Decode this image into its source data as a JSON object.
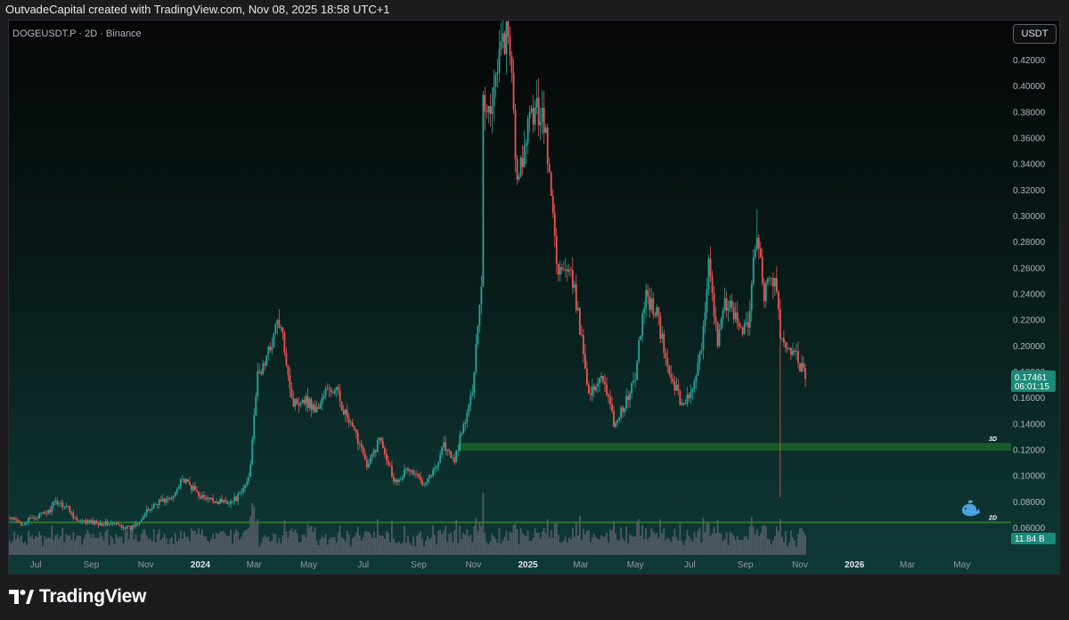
{
  "header": {
    "attribution": "OutvadeCapital created with TradingView.com, Nov 08, 2025 18:58 UTC+1"
  },
  "symbol": {
    "label": "DOGEUSDT.P · 2D · Binance",
    "currency": "USDT"
  },
  "branding": {
    "name": "TradingView"
  },
  "chart_data": {
    "type": "candlestick",
    "title": "DOGEUSDT.P · 2D · Binance",
    "y_axis": {
      "unit": "USDT",
      "range": [
        0.04,
        0.435
      ],
      "ticks": [
        0.06,
        0.08,
        0.1,
        0.12,
        0.14,
        0.16,
        0.18,
        0.2,
        0.22,
        0.24,
        0.26,
        0.28,
        0.3,
        0.32,
        0.34,
        0.36,
        0.38,
        0.4,
        0.42
      ],
      "tick_labels": [
        "0.06000",
        "0.08000",
        "0.10000",
        "0.12000",
        "0.14000",
        "0.16000",
        "0.18000",
        "0.20000",
        "0.22000",
        "0.24000",
        "0.26000",
        "0.28000",
        "0.30000",
        "0.32000",
        "0.34000",
        "0.36000",
        "0.38000",
        "0.40000",
        "0.42000"
      ],
      "position": "right"
    },
    "x_axis": {
      "range": [
        "2023-06-01",
        "2026-06-15"
      ],
      "ticks": [
        {
          "date": "2023-07-01",
          "label": "Jul",
          "bold": false
        },
        {
          "date": "2023-09-01",
          "label": "Sep",
          "bold": false
        },
        {
          "date": "2023-11-01",
          "label": "Nov",
          "bold": false
        },
        {
          "date": "2024-01-01",
          "label": "2024",
          "bold": true
        },
        {
          "date": "2024-03-01",
          "label": "Mar",
          "bold": false
        },
        {
          "date": "2024-05-01",
          "label": "May",
          "bold": false
        },
        {
          "date": "2024-07-01",
          "label": "Jul",
          "bold": false
        },
        {
          "date": "2024-09-01",
          "label": "Sep",
          "bold": false
        },
        {
          "date": "2024-11-01",
          "label": "Nov",
          "bold": false
        },
        {
          "date": "2025-01-01",
          "label": "2025",
          "bold": true
        },
        {
          "date": "2025-03-01",
          "label": "Mar",
          "bold": false
        },
        {
          "date": "2025-05-01",
          "label": "May",
          "bold": false
        },
        {
          "date": "2025-07-01",
          "label": "Jul",
          "bold": false
        },
        {
          "date": "2025-09-01",
          "label": "Sep",
          "bold": false
        },
        {
          "date": "2025-11-01",
          "label": "Nov",
          "bold": false
        },
        {
          "date": "2026-01-01",
          "label": "2026",
          "bold": true
        },
        {
          "date": "2026-03-01",
          "label": "Mar",
          "bold": false
        },
        {
          "date": "2026-05-01",
          "label": "May",
          "bold": false
        }
      ]
    },
    "price_path": [
      [
        "2023-06-01",
        0.067
      ],
      [
        "2023-06-15",
        0.063
      ],
      [
        "2023-07-01",
        0.068
      ],
      [
        "2023-07-15",
        0.072
      ],
      [
        "2023-07-24",
        0.08
      ],
      [
        "2023-08-05",
        0.076
      ],
      [
        "2023-08-17",
        0.064
      ],
      [
        "2023-09-01",
        0.064
      ],
      [
        "2023-09-15",
        0.063
      ],
      [
        "2023-10-01",
        0.062
      ],
      [
        "2023-10-15",
        0.059
      ],
      [
        "2023-10-25",
        0.066
      ],
      [
        "2023-11-05",
        0.074
      ],
      [
        "2023-11-15",
        0.08
      ],
      [
        "2023-12-01",
        0.082
      ],
      [
        "2023-12-10",
        0.098
      ],
      [
        "2023-12-20",
        0.092
      ],
      [
        "2024-01-05",
        0.082
      ],
      [
        "2024-01-20",
        0.08
      ],
      [
        "2024-02-05",
        0.08
      ],
      [
        "2024-02-15",
        0.085
      ],
      [
        "2024-02-25",
        0.1
      ],
      [
        "2024-03-01",
        0.15
      ],
      [
        "2024-03-05",
        0.175
      ],
      [
        "2024-03-15",
        0.19
      ],
      [
        "2024-03-28",
        0.22
      ],
      [
        "2024-04-05",
        0.195
      ],
      [
        "2024-04-13",
        0.155
      ],
      [
        "2024-04-25",
        0.16
      ],
      [
        "2024-05-10",
        0.15
      ],
      [
        "2024-05-20",
        0.165
      ],
      [
        "2024-06-01",
        0.165
      ],
      [
        "2024-06-15",
        0.14
      ],
      [
        "2024-07-01",
        0.12
      ],
      [
        "2024-07-05",
        0.105
      ],
      [
        "2024-07-20",
        0.13
      ],
      [
        "2024-08-05",
        0.095
      ],
      [
        "2024-08-20",
        0.105
      ],
      [
        "2024-09-06",
        0.095
      ],
      [
        "2024-09-20",
        0.105
      ],
      [
        "2024-09-28",
        0.125
      ],
      [
        "2024-10-10",
        0.11
      ],
      [
        "2024-10-20",
        0.135
      ],
      [
        "2024-10-30",
        0.16
      ],
      [
        "2024-11-10",
        0.25
      ],
      [
        "2024-11-12",
        0.39
      ],
      [
        "2024-11-20",
        0.38
      ],
      [
        "2024-11-28",
        0.42
      ],
      [
        "2024-12-08",
        0.44
      ],
      [
        "2024-12-15",
        0.4
      ],
      [
        "2024-12-20",
        0.32
      ],
      [
        "2025-01-05",
        0.38
      ],
      [
        "2025-01-18",
        0.38
      ],
      [
        "2025-01-25",
        0.33
      ],
      [
        "2025-02-03",
        0.26
      ],
      [
        "2025-02-20",
        0.25
      ],
      [
        "2025-03-05",
        0.19
      ],
      [
        "2025-03-11",
        0.16
      ],
      [
        "2025-03-25",
        0.18
      ],
      [
        "2025-04-07",
        0.14
      ],
      [
        "2025-04-20",
        0.155
      ],
      [
        "2025-05-01",
        0.175
      ],
      [
        "2025-05-12",
        0.24
      ],
      [
        "2025-05-25",
        0.225
      ],
      [
        "2025-06-05",
        0.185
      ],
      [
        "2025-06-22",
        0.155
      ],
      [
        "2025-07-05",
        0.165
      ],
      [
        "2025-07-15",
        0.2
      ],
      [
        "2025-07-22",
        0.27
      ],
      [
        "2025-08-01",
        0.2
      ],
      [
        "2025-08-10",
        0.235
      ],
      [
        "2025-08-25",
        0.215
      ],
      [
        "2025-09-05",
        0.215
      ],
      [
        "2025-09-13",
        0.29
      ],
      [
        "2025-09-22",
        0.24
      ],
      [
        "2025-10-05",
        0.255
      ],
      [
        "2025-10-10",
        0.2
      ],
      [
        "2025-10-20",
        0.2
      ],
      [
        "2025-11-01",
        0.185
      ],
      [
        "2025-11-08",
        0.175
      ]
    ],
    "wick_overrides": [
      {
        "date": "2025-10-10",
        "low": 0.083
      },
      {
        "date": "2024-12-08",
        "high": 0.435
      },
      {
        "date": "2025-09-13",
        "high": 0.305
      },
      {
        "date": "2024-03-28",
        "high": 0.228
      }
    ],
    "current_price": {
      "value": 0.17461,
      "label": "0.17461",
      "countdown": "06:01:15"
    },
    "zones": [
      {
        "label": "3D",
        "from": 0.119,
        "to": 0.125,
        "start_date": "2024-10-15",
        "color": "#1b5e2a"
      },
      {
        "label": "2D",
        "from": 0.0635,
        "to": 0.0645,
        "start_date": "2023-06-01",
        "color": "#2e7d32"
      }
    ],
    "volume": {
      "label": "11.84 B"
    },
    "colors": {
      "up": "#26a69a",
      "down": "#ef5350",
      "volume": "#5d606b"
    },
    "grid": false,
    "legend": "none"
  }
}
